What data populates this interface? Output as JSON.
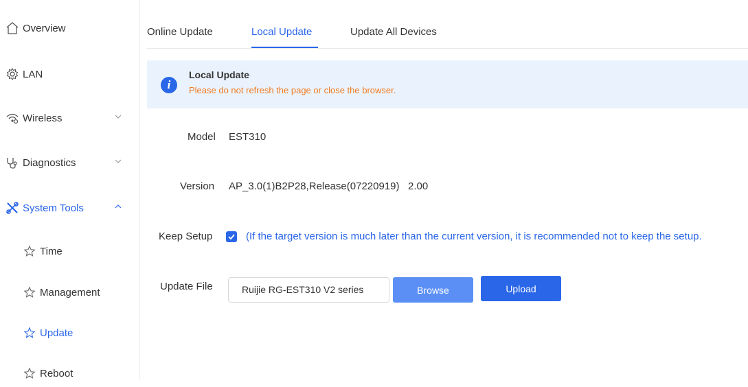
{
  "sidebar": {
    "items": [
      {
        "label": "Overview",
        "icon": "home-icon"
      },
      {
        "label": "LAN",
        "icon": "gear-icon"
      },
      {
        "label": "Wireless",
        "icon": "wifi-icon",
        "caret": "down"
      },
      {
        "label": "Diagnostics",
        "icon": "stethoscope-icon",
        "caret": "down"
      },
      {
        "label": "System Tools",
        "icon": "tools-icon",
        "caret": "up",
        "active": true
      }
    ],
    "subitems": [
      {
        "label": "Time",
        "icon": "star-icon"
      },
      {
        "label": "Management",
        "icon": "star-icon"
      },
      {
        "label": "Update",
        "icon": "star-icon",
        "active": true
      },
      {
        "label": "Reboot",
        "icon": "star-icon"
      }
    ]
  },
  "tabs": [
    {
      "label": "Online Update"
    },
    {
      "label": "Local Update",
      "active": true
    },
    {
      "label": "Update All Devices"
    }
  ],
  "alert": {
    "title": "Local Update",
    "message": "Please do not refresh the page or close the browser."
  },
  "form": {
    "model_label": "Model",
    "model_value": "EST310",
    "version_label": "Version",
    "version_value": "AP_3.0(1)B2P28,Release(07220919)   2.00",
    "keep_label": "Keep Setup",
    "keep_checked": true,
    "keep_text": "(If the target version is much later than the current version, it is recommended not to keep the setup.",
    "file_label": "Update File",
    "file_value": "Ruijie RG-EST310 V2 series",
    "browse_label": "Browse",
    "upload_label": "Upload"
  },
  "colors": {
    "accent": "#2a66e8",
    "warning": "#f07a1e",
    "alert_bg": "#eaf3fd"
  }
}
